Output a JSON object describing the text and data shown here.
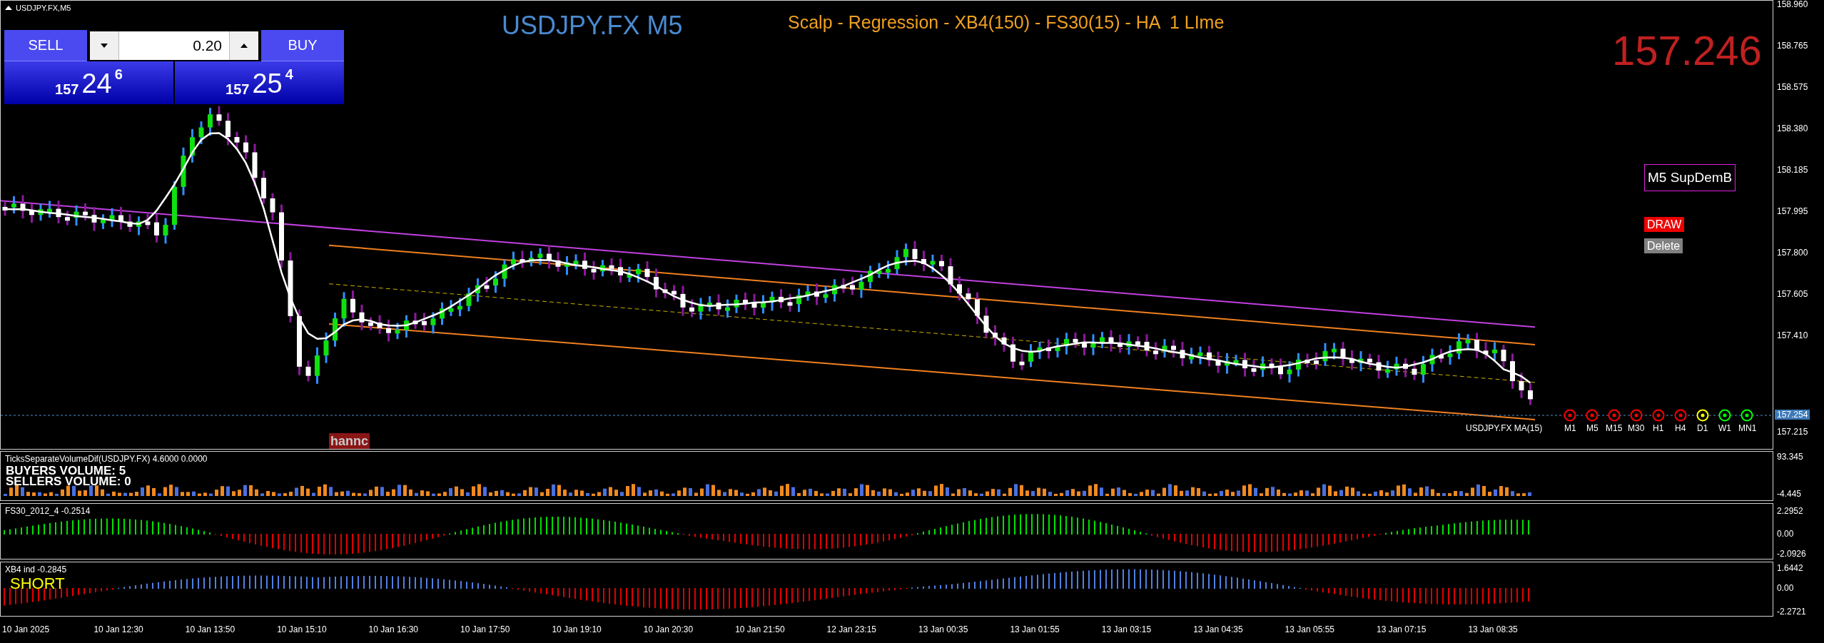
{
  "chart": {
    "symbol_timeframe": "USDJPY.FX,M5"
  },
  "trade_panel": {
    "sell": "SELL",
    "buy": "BUY",
    "lot": "0.20",
    "bid": {
      "handle": "157",
      "pips": "24",
      "fraction": "6"
    },
    "ask": {
      "handle": "157",
      "pips": "25",
      "fraction": "4"
    }
  },
  "title": "USDJPY.FX M5",
  "strategy": "Scalp - Regression - XB4(150) - FS30(15) - HA  1 LIme",
  "last_price": "157.246",
  "main_pane": {
    "price_ticks": [
      "158.960",
      "158.765",
      "158.575",
      "158.380",
      "158.185",
      "157.995",
      "157.800",
      "157.605",
      "157.410"
    ],
    "current_price": "157.254",
    "low_tick": "157.215",
    "ma_label": "USDJPY.FX MA(15)",
    "object_label": "hannc",
    "supdem_label": "M5 SupDemB",
    "buttons": [
      {
        "label": "DRAW",
        "kind": "draw"
      },
      {
        "label": "Delete",
        "kind": "delete"
      }
    ],
    "timeframes": [
      {
        "label": "M1",
        "color": "#ff0000"
      },
      {
        "label": "M5",
        "color": "#ff0000"
      },
      {
        "label": "M15",
        "color": "#ff0000"
      },
      {
        "label": "M30",
        "color": "#ff0000"
      },
      {
        "label": "H1",
        "color": "#ff0000"
      },
      {
        "label": "H4",
        "color": "#ff0000"
      },
      {
        "label": "D1",
        "color": "#ffff00"
      },
      {
        "label": "W1",
        "color": "#00ff00"
      },
      {
        "label": "MN1",
        "color": "#00ff00"
      }
    ]
  },
  "volume_pane": {
    "title": "TicksSeparateVolumeDif(USDJPY.FX) 4.6000 0.0000",
    "buyers": "BUYERS VOLUME: 5",
    "sellers": "SELLERS VOLUME: 0",
    "ticks": [
      "93.345",
      "-4.445"
    ]
  },
  "fs30_pane": {
    "title": "FS30_2012_4 -0.2514",
    "ticks": [
      "2.2952",
      "0.00",
      "-2.0926"
    ]
  },
  "xb4_pane": {
    "title": "XB4 ind -0.2845",
    "signal": "SHORT",
    "ticks": [
      "1.6442",
      "0.00",
      "-2.2721"
    ]
  },
  "time_axis": [
    "10 Jan 2025",
    "10 Jan 12:30",
    "10 Jan 13:50",
    "10 Jan 15:10",
    "10 Jan 16:30",
    "10 Jan 17:50",
    "10 Jan 19:10",
    "10 Jan 20:30",
    "10 Jan 21:50",
    "12 Jan 23:15",
    "13 Jan 00:35",
    "13 Jan 01:55",
    "13 Jan 03:15",
    "13 Jan 04:35",
    "13 Jan 05:55",
    "13 Jan 07:15",
    "13 Jan 08:35"
  ]
}
